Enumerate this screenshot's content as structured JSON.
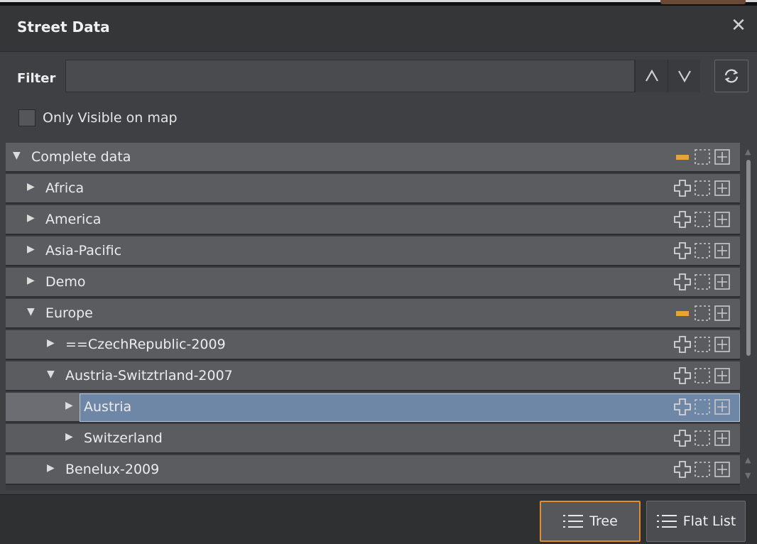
{
  "window": {
    "title": "Street Data"
  },
  "filter": {
    "label": "Filter",
    "value": "",
    "placeholder": ""
  },
  "only_visible": {
    "label": "Only Visible on map",
    "checked": false
  },
  "tree": {
    "rows": [
      {
        "label": "Complete data",
        "expanded": true,
        "level": 0,
        "status": "partial"
      },
      {
        "label": "Africa",
        "expanded": false,
        "level": 1,
        "status": "add"
      },
      {
        "label": "America",
        "expanded": false,
        "level": 1,
        "status": "add"
      },
      {
        "label": "Asia-Pacific",
        "expanded": false,
        "level": 1,
        "status": "add"
      },
      {
        "label": "Demo",
        "expanded": false,
        "level": 1,
        "status": "add"
      },
      {
        "label": "Europe",
        "expanded": true,
        "level": 1,
        "status": "partial"
      },
      {
        "label": "==CzechRepublic-2009",
        "expanded": false,
        "level": 2,
        "status": "add"
      },
      {
        "label": "Austria-Switztrland-2007",
        "expanded": true,
        "level": 2,
        "status": "add"
      },
      {
        "label": "Austria",
        "expanded": false,
        "level": 3,
        "status": "add",
        "selected": true
      },
      {
        "label": "Switzerland",
        "expanded": false,
        "level": 3,
        "status": "add"
      },
      {
        "label": "Benelux-2009",
        "expanded": false,
        "level": 2,
        "status": "add"
      }
    ]
  },
  "view_buttons": {
    "tree_label": "Tree",
    "flat_label": "Flat List",
    "active": "tree"
  },
  "colors": {
    "accent": "#e38c2c",
    "selection": "#6f87a7"
  },
  "icons": {
    "close": "close-icon",
    "up": "chevron-up-icon",
    "down": "chevron-down-icon",
    "refresh": "refresh-icon",
    "partial": "partial-indicator-icon",
    "add": "add-outline-icon",
    "select": "dashed-select-icon",
    "expand": "plus-box-icon",
    "list": "list-icon"
  }
}
